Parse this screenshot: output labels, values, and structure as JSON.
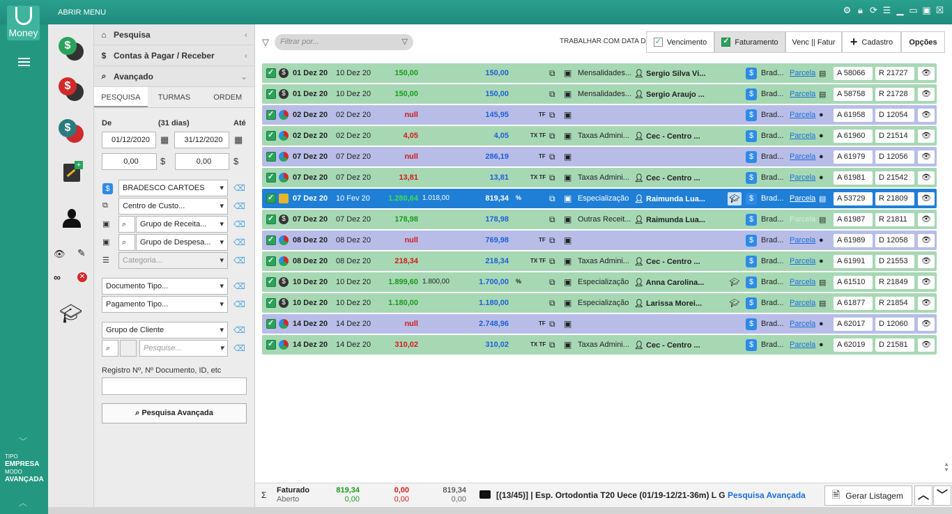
{
  "app": {
    "logo_text": "Money",
    "menu_title": "ABRIR MENU"
  },
  "sidebar": {
    "tipo_label": "TIPO",
    "tipo_value": "EMPRESA",
    "modo_label": "MODO",
    "modo_value": "AVANÇADA"
  },
  "panel": {
    "accordion": [
      {
        "label": "Pesquisa",
        "icon": "home-icon"
      },
      {
        "label": "Contas à Pagar / Receber",
        "icon": "money-icon"
      },
      {
        "label": "Avançado",
        "icon": "search-icon"
      }
    ],
    "tabs": [
      "PESQUISA",
      "TURMAS",
      "ORDEM"
    ],
    "date": {
      "de_label": "De",
      "days_label": "(31 dias)",
      "ate_label": "Até",
      "de_value": "01/12/2020",
      "ate_value": "31/12/2020"
    },
    "amounts": {
      "min": "0,00",
      "max": "0,00"
    },
    "selects": {
      "bank": "BRADESCO CARTOES",
      "centro": "Centro de Custo...",
      "receita": "Grupo de Receita...",
      "despesa": "Grupo de Despesa...",
      "categoria": "Categoria...",
      "documento": "Documento Tipo...",
      "pagamento": "Pagamento Tipo...",
      "grupo_cliente": "Grupo de Cliente",
      "pesquise_placeholder": "Pesquise..."
    },
    "registro_label": "Registro Nº, Nº Documento, ID, etc",
    "search_button": "Pesquisa Avançada"
  },
  "toolbar": {
    "filter_placeholder": "Filtrar por...",
    "trabalhar_label": "TRABALHAR COM DATA DE",
    "vencimento": "Vencimento",
    "faturamento": "Faturamento",
    "venc_fatur": "Venc || Fatur",
    "cadastro": "Cadastro",
    "opcoes": "Opções"
  },
  "rows": [
    {
      "color": "g",
      "stat": "$",
      "d1": "01 Dez 20",
      "d2": "10 Dez 20",
      "v1": "150,00",
      "v1c": "#1a9a1a",
      "v2": "",
      "v3": "150,00",
      "pct": "",
      "tf": "",
      "cat": "Mensalidades...",
      "pers": "Sergio Silva Vi...",
      "grad": false,
      "bank": "Brad...",
      "parc": "Parcela",
      "card": "card",
      "a": "A 58066",
      "r": "R 21727"
    },
    {
      "color": "g",
      "stat": "$",
      "d1": "01 Dez 20",
      "d2": "10 Dez 20",
      "v1": "150,00",
      "v1c": "#1a9a1a",
      "v2": "",
      "v3": "150,00",
      "pct": "",
      "tf": "",
      "cat": "Mensalidades...",
      "pers": "Sergio Araujo ...",
      "grad": false,
      "bank": "Brad...",
      "parc": "Parcela",
      "card": "card",
      "a": "A 58758",
      "r": "R 21728"
    },
    {
      "color": "b",
      "stat": "G",
      "d1": "02 Dez 20",
      "d2": "02 Dez 20",
      "v1": "null",
      "v1c": "#d21b1b",
      "v2": "",
      "v3": "145,95",
      "pct": "",
      "tf": "TF",
      "cat": "",
      "pers": "",
      "grad": false,
      "bank": "Brad...",
      "parc": "Parcela",
      "card": "coin",
      "a": "A 61958",
      "r": "D 12054"
    },
    {
      "color": "g",
      "stat": "G",
      "d1": "02 Dez 20",
      "d2": "02 Dez 20",
      "v1": "4,05",
      "v1c": "#d21b1b",
      "v2": "",
      "v3": "4,05",
      "pct": "",
      "tf": "TX TF",
      "cat": "Taxas Admini...",
      "pers": "Cec - Centro ...",
      "grad": false,
      "bank": "Brad...",
      "parc": "Parcela",
      "card": "coin",
      "a": "A 61960",
      "r": "D 21514"
    },
    {
      "color": "b",
      "stat": "G",
      "d1": "07 Dez 20",
      "d2": "07 Dez 20",
      "v1": "null",
      "v1c": "#d21b1b",
      "v2": "",
      "v3": "286,19",
      "pct": "",
      "tf": "TF",
      "cat": "",
      "pers": "",
      "grad": false,
      "bank": "Brad...",
      "parc": "Parcela",
      "card": "coin",
      "a": "A 61979",
      "r": "D 12056"
    },
    {
      "color": "g",
      "stat": "G",
      "d1": "07 Dez 20",
      "d2": "07 Dez 20",
      "v1": "13,81",
      "v1c": "#d21b1b",
      "v2": "",
      "v3": "13,81",
      "pct": "",
      "tf": "TX TF",
      "cat": "Taxas Admini...",
      "pers": "Cec - Centro ...",
      "grad": false,
      "bank": "Brad...",
      "parc": "Parcela",
      "card": "coin",
      "a": "A 61981",
      "r": "D 21542"
    },
    {
      "color": "s",
      "stat": "Y",
      "d1": "07 Dez 20",
      "d2": "10 Fev 20",
      "v1": "1.280,64",
      "v1c": "#3ee04a",
      "v2": "1.018,00",
      "v3": "819,34",
      "pct": "%",
      "tf": "",
      "cat": "Especialização",
      "pers": "Raimunda Lua...",
      "grad": true,
      "gradhl": true,
      "bank": "Brad...",
      "parc": "Parcela",
      "card": "card",
      "a": "A 53729",
      "r": "R 21809"
    },
    {
      "color": "g",
      "stat": "$",
      "d1": "07 Dez 20",
      "d2": "07 Dez 20",
      "v1": "178,98",
      "v1c": "#1a9a1a",
      "v2": "",
      "v3": "178,98",
      "pct": "",
      "tf": "",
      "cat": "Outras Receit...",
      "pers": "Raimunda Lua...",
      "grad": false,
      "bank": "Brad...",
      "parc": "Parcela",
      "parcfaded": true,
      "card": "card",
      "a": "A 61987",
      "r": "R 21811"
    },
    {
      "color": "b",
      "stat": "G",
      "d1": "08 Dez 20",
      "d2": "08 Dez 20",
      "v1": "null",
      "v1c": "#d21b1b",
      "v2": "",
      "v3": "769,98",
      "pct": "",
      "tf": "TF",
      "cat": "",
      "pers": "",
      "grad": false,
      "bank": "Brad...",
      "parc": "Parcela",
      "card": "coin",
      "a": "A 61989",
      "r": "D 12058"
    },
    {
      "color": "g",
      "stat": "G",
      "d1": "08 Dez 20",
      "d2": "08 Dez 20",
      "v1": "218,34",
      "v1c": "#d21b1b",
      "v2": "",
      "v3": "218,34",
      "pct": "",
      "tf": "TX TF",
      "cat": "Taxas Admini...",
      "pers": "Cec - Centro ...",
      "grad": false,
      "bank": "Brad...",
      "parc": "Parcela",
      "card": "coin",
      "a": "A 61991",
      "r": "D 21553"
    },
    {
      "color": "g",
      "stat": "$",
      "d1": "10 Dez 20",
      "d2": "10 Dez 20",
      "v1": "1.899,60",
      "v1c": "#1a9a1a",
      "v2": "1.800,00",
      "v3": "1.700,00",
      "pct": "%",
      "tf": "",
      "cat": "Especialização",
      "pers": "Anna Carolina...",
      "grad": true,
      "bank": "Brad...",
      "parc": "Parcela",
      "card": "card",
      "a": "A 61510",
      "r": "R 21849"
    },
    {
      "color": "g",
      "stat": "$",
      "d1": "10 Dez 20",
      "d2": "10 Dez 20",
      "v1": "1.180,00",
      "v1c": "#1a9a1a",
      "v2": "",
      "v3": "1.180,00",
      "pct": "",
      "tf": "",
      "cat": "Especialização",
      "pers": "Larissa Morei...",
      "grad": true,
      "bank": "Brad...",
      "parc": "Parcela",
      "card": "card",
      "a": "A 61877",
      "r": "R 21854"
    },
    {
      "color": "b",
      "stat": "G",
      "d1": "14 Dez 20",
      "d2": "14 Dez 20",
      "v1": "null",
      "v1c": "#d21b1b",
      "v2": "",
      "v3": "2.748,96",
      "pct": "",
      "tf": "TF",
      "cat": "",
      "pers": "",
      "grad": false,
      "bank": "Brad...",
      "parc": "Parcela",
      "card": "coin",
      "a": "A 62017",
      "r": "D 12060"
    },
    {
      "color": "g",
      "stat": "G",
      "d1": "14 Dez 20",
      "d2": "14 Dez 20",
      "v1": "310,02",
      "v1c": "#d21b1b",
      "v2": "",
      "v3": "310,02",
      "pct": "",
      "tf": "TX TF",
      "cat": "Taxas Admini...",
      "pers": "Cec - Centro ...",
      "grad": false,
      "bank": "Brad...",
      "parc": "Parcela",
      "card": "coin",
      "a": "A 62019",
      "r": "D 21581"
    }
  ],
  "footer": {
    "sigma": "Σ",
    "faturado": "Faturado",
    "aberto": "Aberto",
    "g1a": "819,34",
    "g1b": "0,00",
    "r1a": "0,00",
    "r1b": "0,00",
    "n1a": "819,34",
    "n1b": "0,00",
    "course": "[(13/45)] | Esp. Ortodontia T20 Uece (01/19-12/21-36m) L G",
    "adv_link": "Pesquisa Avançada",
    "gerar": "Gerar Listagem"
  }
}
